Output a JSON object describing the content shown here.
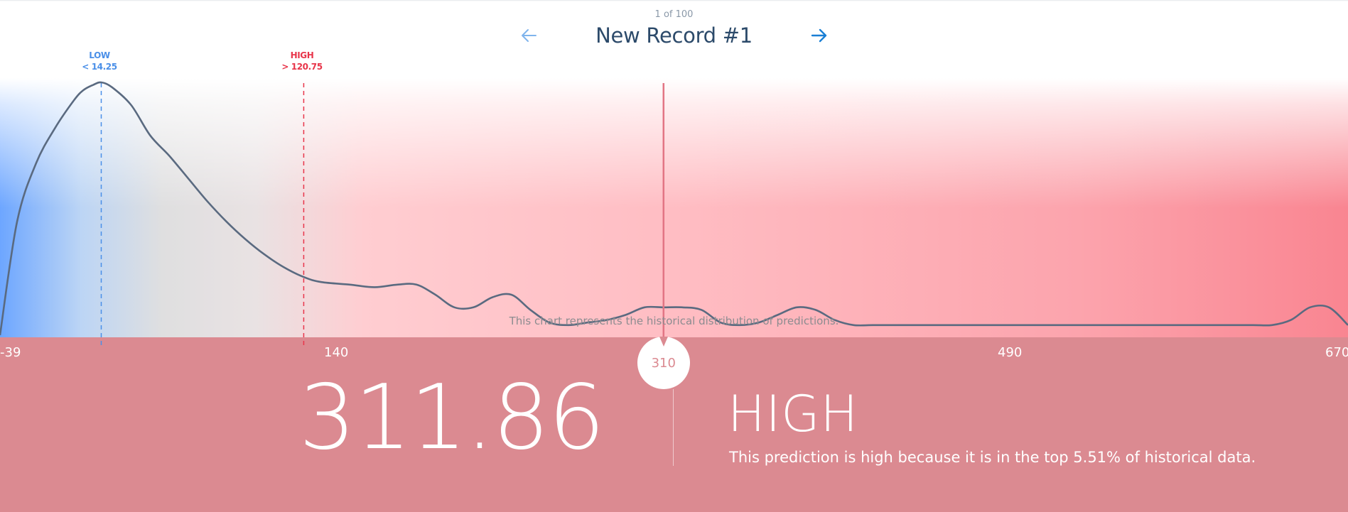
{
  "header": {
    "record_counter": "1 of 100",
    "record_title": "New Record #1",
    "prev_icon": "arrow-left-icon",
    "next_icon": "arrow-right-icon"
  },
  "thresholds": {
    "low_title": "LOW",
    "low_value": "< 14.25",
    "high_title": "HIGH",
    "high_value": "> 120.75"
  },
  "chart_caption": "This chart represents the historical distribution of predictions.",
  "chart_data": {
    "type": "area",
    "title": "",
    "xlabel": "",
    "ylabel": "",
    "x_ticks": [
      "-39",
      "140",
      "490",
      "670"
    ],
    "xlim": [
      -39,
      670
    ],
    "ylim": [
      0,
      1
    ],
    "low_threshold": 14.25,
    "high_threshold": 120.75,
    "prediction_marker": 310,
    "series": [
      {
        "x": [
          -39,
          -30,
          -20,
          -10,
          0,
          5,
          10,
          14.25,
          20,
          30,
          40,
          50,
          60,
          70,
          80,
          90,
          100,
          110,
          120.75,
          130,
          145,
          158,
          170,
          180,
          190,
          200,
          210,
          220,
          230,
          240,
          250,
          260,
          270,
          280,
          290,
          300,
          310,
          320,
          330,
          340,
          350,
          360,
          370,
          380,
          390,
          400,
          410,
          420,
          430,
          440,
          450,
          460,
          470,
          480,
          490,
          500,
          520,
          540,
          560,
          580,
          600,
          620,
          630,
          640,
          650,
          660,
          670
        ],
        "y": [
          0.0,
          0.45,
          0.68,
          0.82,
          0.93,
          0.97,
          0.99,
          1.0,
          0.98,
          0.91,
          0.79,
          0.71,
          0.62,
          0.53,
          0.45,
          0.38,
          0.32,
          0.27,
          0.23,
          0.21,
          0.2,
          0.19,
          0.2,
          0.2,
          0.16,
          0.11,
          0.11,
          0.15,
          0.16,
          0.1,
          0.05,
          0.04,
          0.05,
          0.06,
          0.08,
          0.11,
          0.11,
          0.11,
          0.1,
          0.05,
          0.04,
          0.05,
          0.08,
          0.11,
          0.1,
          0.06,
          0.04,
          0.04,
          0.04,
          0.04,
          0.04,
          0.04,
          0.04,
          0.04,
          0.04,
          0.04,
          0.04,
          0.04,
          0.04,
          0.04,
          0.04,
          0.04,
          0.04,
          0.06,
          0.11,
          0.11,
          0.04
        ]
      }
    ]
  },
  "prediction": {
    "marker_label": "310",
    "value": "311.86",
    "class_label": "HIGH",
    "explanation": "This prediction is high because it is in the top 5.51% of historical data."
  },
  "colors": {
    "low": "#4a8fe8",
    "high": "#e8354a",
    "curve": "#5a6a80",
    "marker_line": "#e27584",
    "panel": "#db8a91"
  }
}
